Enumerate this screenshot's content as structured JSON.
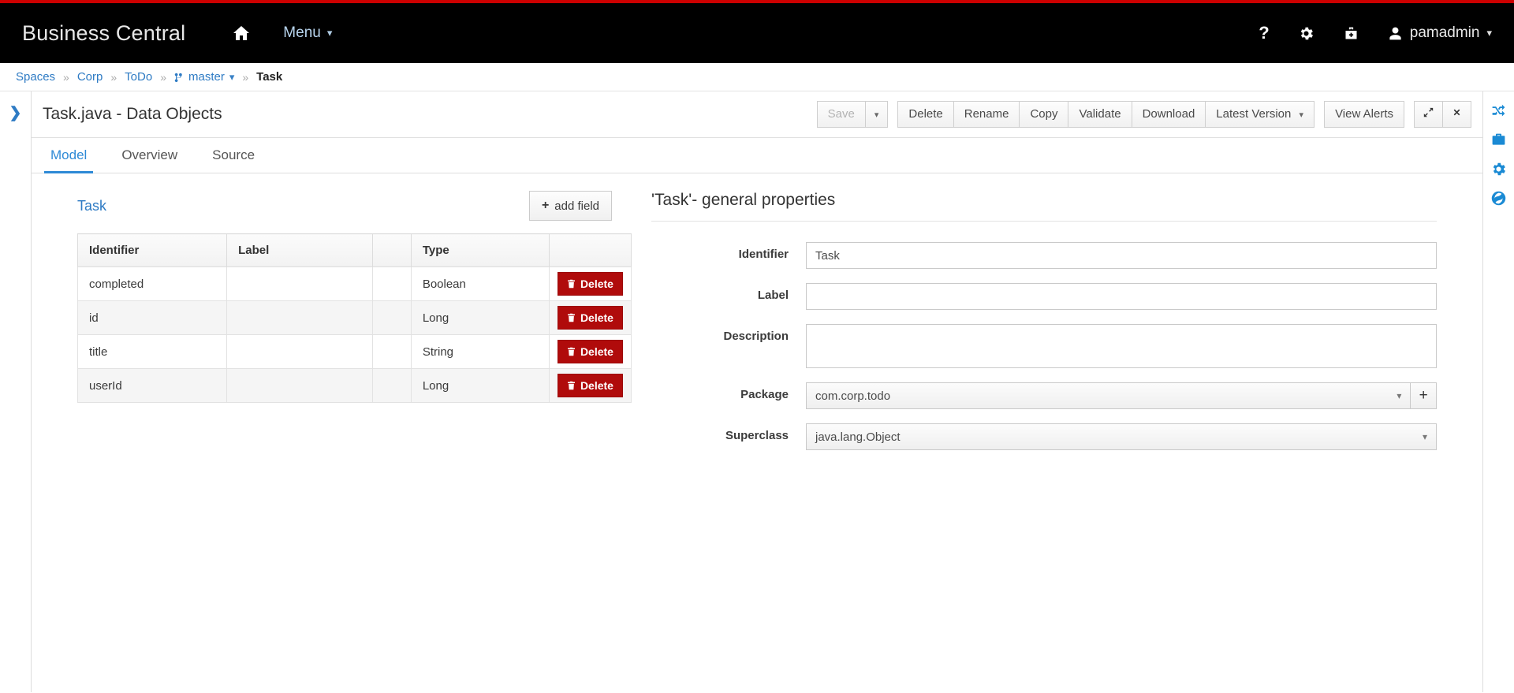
{
  "navbar": {
    "brand": "Business Central",
    "home_icon": "home-icon",
    "menu_label": "Menu",
    "help_icon": "question-mark-icon",
    "settings_icon": "gear-icon",
    "toolbox_icon": "briefcase-icon",
    "user_icon": "user-icon",
    "username": "pamadmin"
  },
  "breadcrumb": {
    "spaces": "Spaces",
    "corp": "Corp",
    "todo": "ToDo",
    "branch": "master",
    "branch_icon": "git-branch-icon",
    "current": "Task",
    "separator": "»"
  },
  "left_rail": {
    "toggle_icon": "chevron-right-icon"
  },
  "editor": {
    "title": "Task.java - Data Objects",
    "toolbar": {
      "save": "Save",
      "save_caret_icon": "chevron-down-icon",
      "delete": "Delete",
      "rename": "Rename",
      "copy": "Copy",
      "validate": "Validate",
      "download": "Download",
      "latest_version": "Latest Version",
      "version_caret_icon": "chevron-down-icon",
      "view_alerts": "View Alerts",
      "maximize_icon": "expand-arrows-icon",
      "close_icon": "close-x-icon"
    },
    "tabs": [
      {
        "label": "Model",
        "active": true
      },
      {
        "label": "Overview",
        "active": false
      },
      {
        "label": "Source",
        "active": false
      }
    ]
  },
  "model": {
    "name": "Task",
    "add_field_label": "add field",
    "add_field_icon": "plus-icon",
    "columns": [
      "Identifier",
      "Label",
      "",
      "Type",
      ""
    ],
    "rows": [
      {
        "identifier": "completed",
        "label": "",
        "type": "Boolean",
        "action": "Delete"
      },
      {
        "identifier": "id",
        "label": "",
        "type": "Long",
        "action": "Delete"
      },
      {
        "identifier": "title",
        "label": "",
        "type": "String",
        "action": "Delete"
      },
      {
        "identifier": "userId",
        "label": "",
        "type": "Long",
        "action": "Delete"
      }
    ],
    "delete_icon": "trash-icon"
  },
  "properties": {
    "title": "'Task'- general properties",
    "identifier_label": "Identifier",
    "identifier_value": "Task",
    "label_label": "Label",
    "label_value": "",
    "description_label": "Description",
    "description_value": "",
    "package_label": "Package",
    "package_value": "com.corp.todo",
    "package_add_icon": "plus-icon",
    "superclass_label": "Superclass",
    "superclass_value": "java.lang.Object",
    "caret_icon": "chevron-down-icon"
  },
  "right_rail": {
    "icons": [
      "shuffle-icon",
      "briefcase-icon",
      "gear-icon",
      "globe-icon"
    ]
  },
  "colors": {
    "accent_red": "#cc0000",
    "link_blue": "#2e7bc4",
    "tab_active": "#2e8ad6",
    "delete_red": "#b00b0b",
    "rail_icon_blue": "#1a8ad4"
  }
}
